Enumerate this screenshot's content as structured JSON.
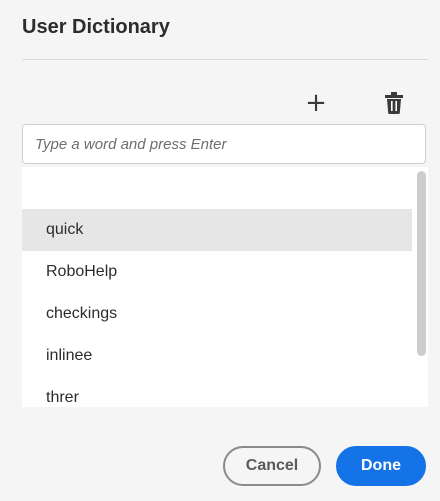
{
  "dialog": {
    "title": "User Dictionary"
  },
  "toolbar": {
    "add_icon": "plus-icon",
    "add_glyph": "+",
    "delete_icon": "trash-icon"
  },
  "input": {
    "placeholder": "Type a word and press Enter",
    "value": ""
  },
  "words": {
    "items": [
      {
        "label": ""
      },
      {
        "label": "quick",
        "selected": true
      },
      {
        "label": "RoboHelp"
      },
      {
        "label": "checkings"
      },
      {
        "label": "inlinee"
      },
      {
        "label": "threr"
      }
    ]
  },
  "footer": {
    "cancel_label": "Cancel",
    "done_label": "Done"
  },
  "colors": {
    "accent": "#1473e6",
    "selected_row": "#e6e6e6",
    "background": "#f5f5f5"
  }
}
